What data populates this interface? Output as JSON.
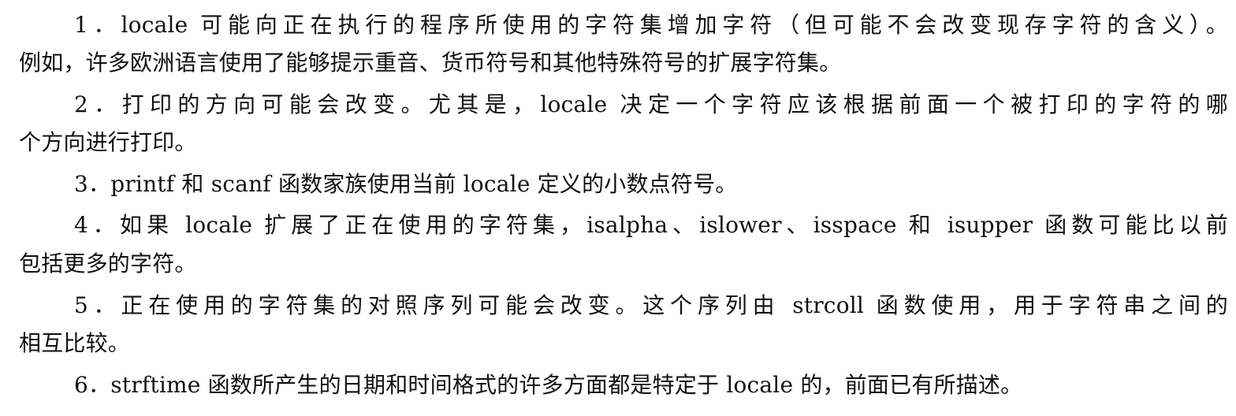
{
  "document": {
    "lines": [
      "1．locale 可能向正在执行的程序所使用的字符集增加字符（但可能不会改变现存字符的含义）。",
      "例如，许多欧洲语言使用了能够提示重音、货币符号和其他特殊符号的扩展字符集。",
      "2．打印的方向可能会改变。尤其是，locale 决定一个字符应该根据前面一个被打印的字符的哪",
      "个方向进行打印。",
      "3．printf 和 scanf 函数家族使用当前 locale 定义的小数点符号。",
      "4．如果 locale 扩展了正在使用的字符集，isalpha、islower、isspace 和 isupper 函数可能比以前",
      "包括更多的字符。",
      "5．正在使用的字符集的对照序列可能会改变。这个序列由 strcoll 函数使用，用于字符串之间的",
      "相互比较。",
      "6．strftime 函数所产生的日期和时间格式的许多方面都是特定于 locale 的，前面已有所描述。"
    ]
  }
}
